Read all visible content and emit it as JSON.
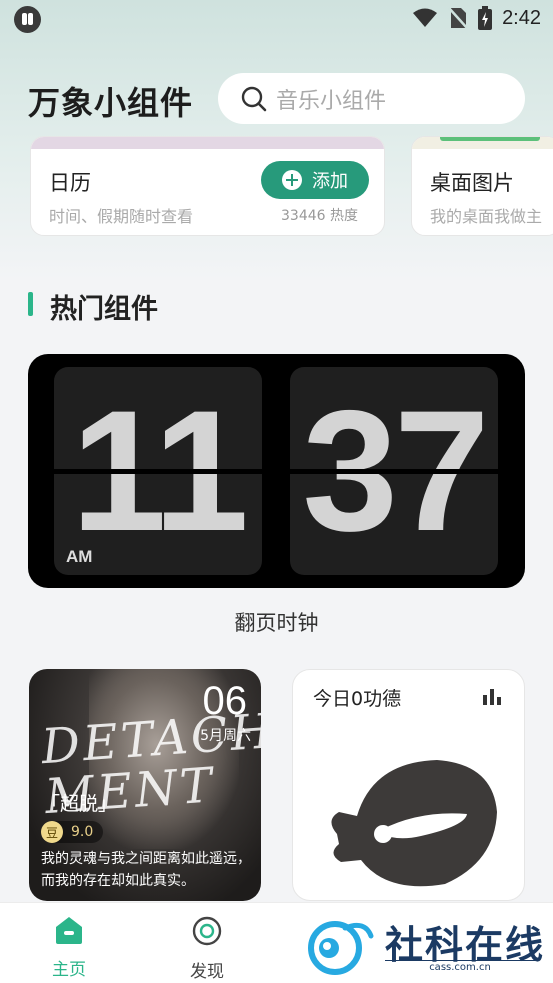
{
  "status_bar": {
    "time": "2:42"
  },
  "header": {
    "title": "万象小组件",
    "search_placeholder": "音乐小组件"
  },
  "featured": [
    {
      "title": "日历",
      "description": "时间、假期随时查看",
      "add_label": "添加",
      "heat": "33446 热度"
    },
    {
      "title": "桌面图片",
      "description": "我的桌面我做主"
    }
  ],
  "section": {
    "title": "热门组件"
  },
  "flip_clock": {
    "hour": "11",
    "minute": "37",
    "period": "AM",
    "caption": "翻页时钟"
  },
  "movie_widget": {
    "art_text": "DETACH MENT",
    "day": "06",
    "weekday": "5月周六",
    "title": "「超脱」",
    "rating_icon": "豆",
    "rating": "9.0",
    "quote": "我的灵魂与我之间距离如此遥远，而我的存在却如此真实。"
  },
  "merit_widget": {
    "title": "今日0功德"
  },
  "nav": {
    "home": "主页",
    "discover": "发现"
  },
  "watermark": {
    "name": "社科在线",
    "url": "cass.com.cn"
  },
  "colors": {
    "accent": "#2bb58a",
    "button": "#279a7b"
  }
}
